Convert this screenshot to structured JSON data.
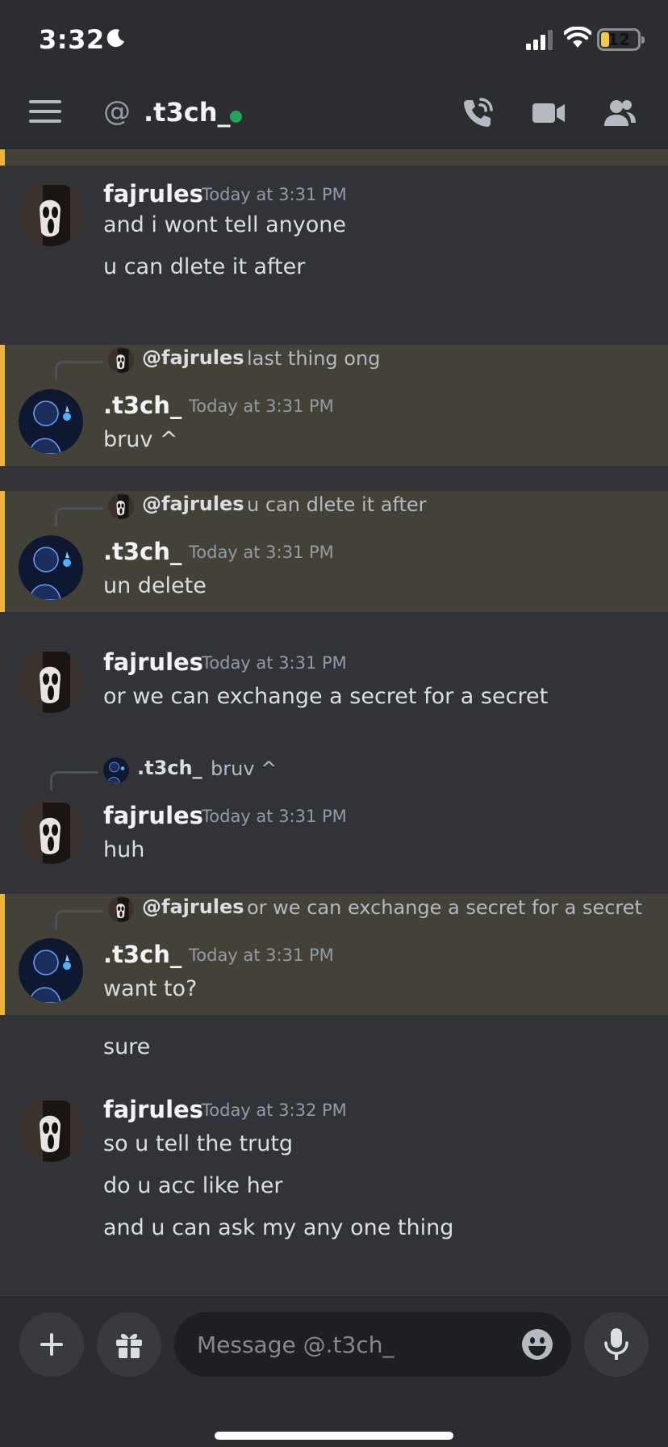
{
  "status_bar": {
    "time": "3:32",
    "battery": "12"
  },
  "header": {
    "at_symbol": "@",
    "title": ".t3ch_"
  },
  "messages": [
    {
      "username": "fajrules",
      "timestamp": "Today at 3:31 PM",
      "lines": [
        "and i wont tell anyone",
        "u can dlete it after"
      ]
    },
    {
      "reply": {
        "name": "@fajrules",
        "text": "last thing ong"
      },
      "username": ".t3ch_",
      "timestamp": "Today at 3:31 PM",
      "lines": [
        "bruv ^"
      ]
    },
    {
      "reply": {
        "name": "@fajrules",
        "text": "u can dlete it after"
      },
      "username": ".t3ch_",
      "timestamp": "Today at 3:31 PM",
      "lines": [
        "un delete"
      ]
    },
    {
      "username": "fajrules",
      "timestamp": "Today at 3:31 PM",
      "lines": [
        "or we can exchange a secret for a secret"
      ]
    },
    {
      "reply": {
        "name": ".t3ch_",
        "text": "bruv ^"
      },
      "username": "fajrules",
      "timestamp": "Today at 3:31 PM",
      "lines": [
        "huh"
      ]
    },
    {
      "reply": {
        "name": "@fajrules",
        "text": "or we can exchange a secret for a secret"
      },
      "username": ".t3ch_",
      "timestamp": "Today at 3:31 PM",
      "lines": [
        "want to?",
        "sure"
      ]
    },
    {
      "username": "fajrules",
      "timestamp": "Today at 3:32 PM",
      "lines": [
        "so u tell the trutg",
        "do u acc like her",
        "and u can ask my any one thing"
      ]
    }
  ],
  "composer": {
    "placeholder": "Message @.t3ch_"
  },
  "colors": {
    "accent_highlight": "#f0b232",
    "online": "#23a55a",
    "highlight_bg": "#444138"
  },
  "icons": [
    "moon-icon",
    "signal-icon",
    "wifi-icon",
    "menu-icon",
    "call-icon",
    "video-icon",
    "members-icon",
    "plus-icon",
    "gift-icon",
    "emoji-icon",
    "mic-icon"
  ]
}
